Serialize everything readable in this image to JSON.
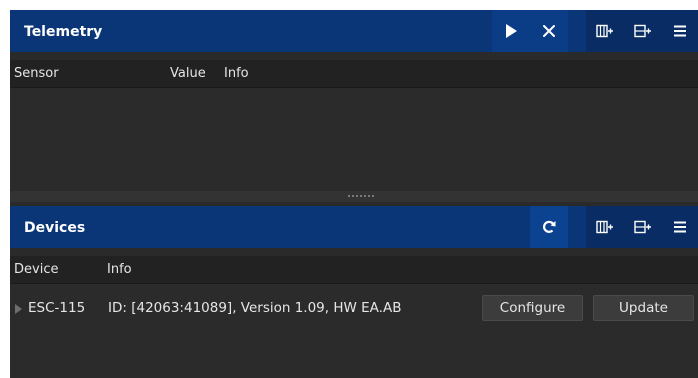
{
  "telemetry": {
    "title": "Telemetry",
    "columns": {
      "sensor": "Sensor",
      "value": "Value",
      "info": "Info"
    },
    "buttons": {
      "play_icon": "play-icon",
      "clear_icon": "close-icon",
      "add_column_icon": "add-column-icon",
      "add_row_icon": "add-row-icon",
      "menu_icon": "menu-icon"
    }
  },
  "devices": {
    "title": "Devices",
    "columns": {
      "device": "Device",
      "info": "Info"
    },
    "buttons": {
      "refresh_icon": "refresh-icon",
      "add_column_icon": "add-column-icon",
      "add_row_icon": "add-row-icon",
      "menu_icon": "menu-icon"
    },
    "rows": [
      {
        "name": "ESC-115",
        "info": "ID: [42063:41089], Version  1.09, HW EA.AB",
        "configure_label": "Configure",
        "update_label": "Update"
      }
    ]
  },
  "colors": {
    "header_bg": "#0a3678",
    "header_btn": "#0b3d86",
    "panel_bg": "#2b2b2b",
    "text": "#e6e6e6"
  }
}
